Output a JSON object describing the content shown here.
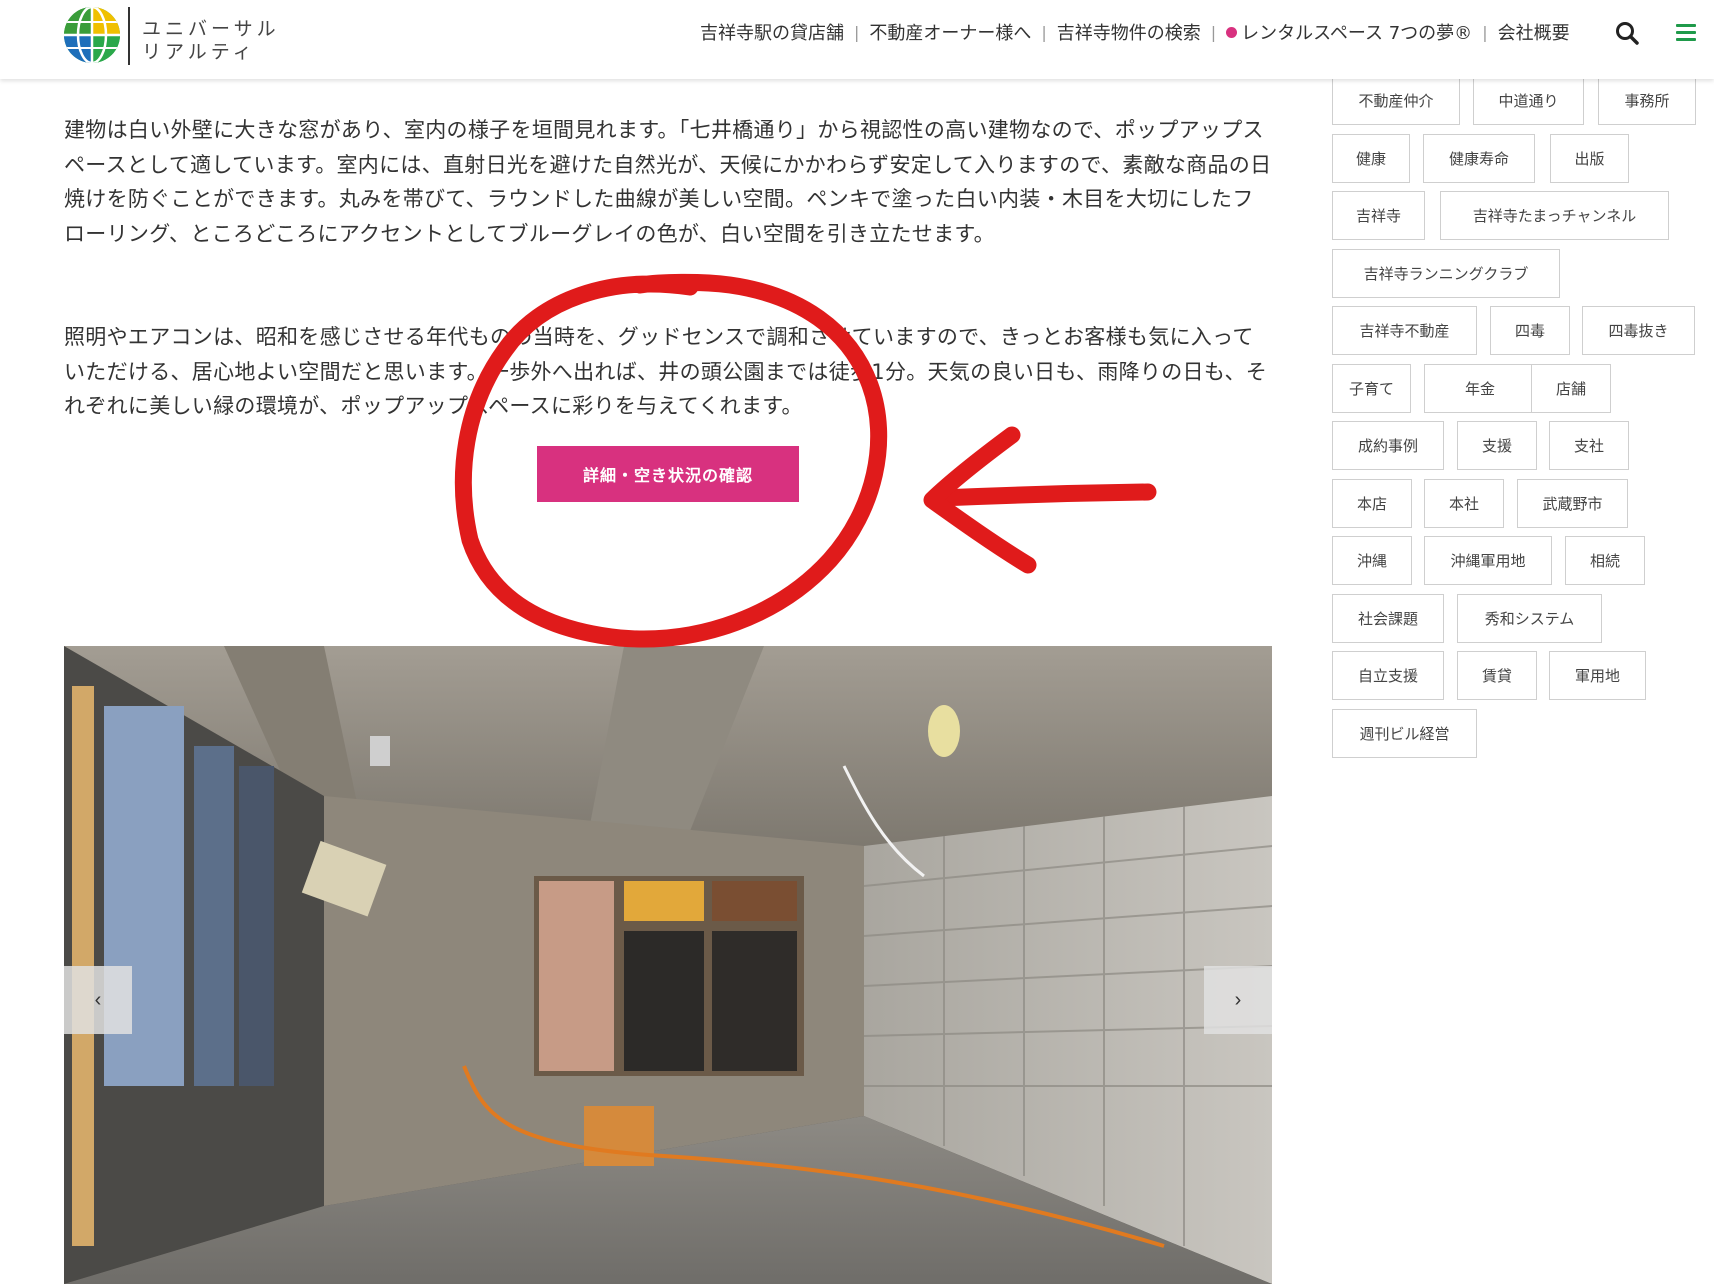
{
  "header": {
    "logo_text_line1": "ユニバーサル",
    "logo_text_line2": "リアルティ",
    "nav": [
      {
        "label": "吉祥寺駅の貸店舗"
      },
      {
        "label": "不動産オーナー様へ"
      },
      {
        "label": "吉祥寺物件の検索"
      },
      {
        "label": "レンタルスペース 7つの夢®",
        "has_dot": true,
        "dot_color": "#d8317f"
      },
      {
        "label": "会社概要"
      }
    ],
    "nav_separator": "|",
    "search_icon": "search-icon",
    "menu_icon": "hamburger-menu-icon",
    "brand_color": "#1f9a4a"
  },
  "article": {
    "paragraph1": "建物は白い外壁に大きな窓があり、室内の様子を垣間見れます。「七井橋通り」から視認性の高い建物なので、ポップアップスペースとして適しています。室内には、直射日光を避けた自然光が、天候にかかわらず安定して入りますので、素敵な商品の日焼けを防ぐことができます。丸みを帯びて、ラウンドした曲線が美しい空間。ペンキで塗った白い内装・木目を大切にしたフローリング、ところどころにアクセントとしてブルーグレイの色が、白い空間を引き立たせます。",
    "paragraph2": "照明やエアコンは、昭和を感じさせる年代ものの当時を、グッドセンスで調和させていますので、きっとお客様も気に入っていただける、居心地よい空間だと思います。一歩外へ出れば、井の頭公園までは徒歩1分。天気の良い日も、雨降りの日も、それぞれに美しい緑の環境が、ポップアップスペースに彩りを与えてくれます。",
    "cta_label": "詳細・空き状況の確認",
    "cta_color": "#d8317f"
  },
  "annotation": {
    "color": "#e01b1b",
    "shapes": [
      "circle-around-cta",
      "arrow-pointing-left"
    ]
  },
  "slider": {
    "prev_label": "‹",
    "next_label": "›"
  },
  "tags": [
    [
      "不動産仲介",
      "中道通り",
      "事務所"
    ],
    [
      "健康",
      "健康寿命",
      "出版"
    ],
    [
      "吉祥寺",
      "吉祥寺たまっチャンネル"
    ],
    [
      "吉祥寺ランニングクラブ"
    ],
    [
      "吉祥寺不動産",
      "四毒",
      "四毒抜き"
    ],
    [
      "子育て",
      "年金",
      "店舗"
    ],
    [
      "成約事例",
      "支援",
      "支社"
    ],
    [
      "本店",
      "本社",
      "武蔵野市"
    ],
    [
      "沖縄",
      "沖縄軍用地",
      "相続"
    ],
    [
      "社会課題",
      "秀和システム"
    ],
    [
      "自立支援",
      "賃貸",
      "軍用地"
    ],
    [
      "週刊ビル経営"
    ]
  ]
}
